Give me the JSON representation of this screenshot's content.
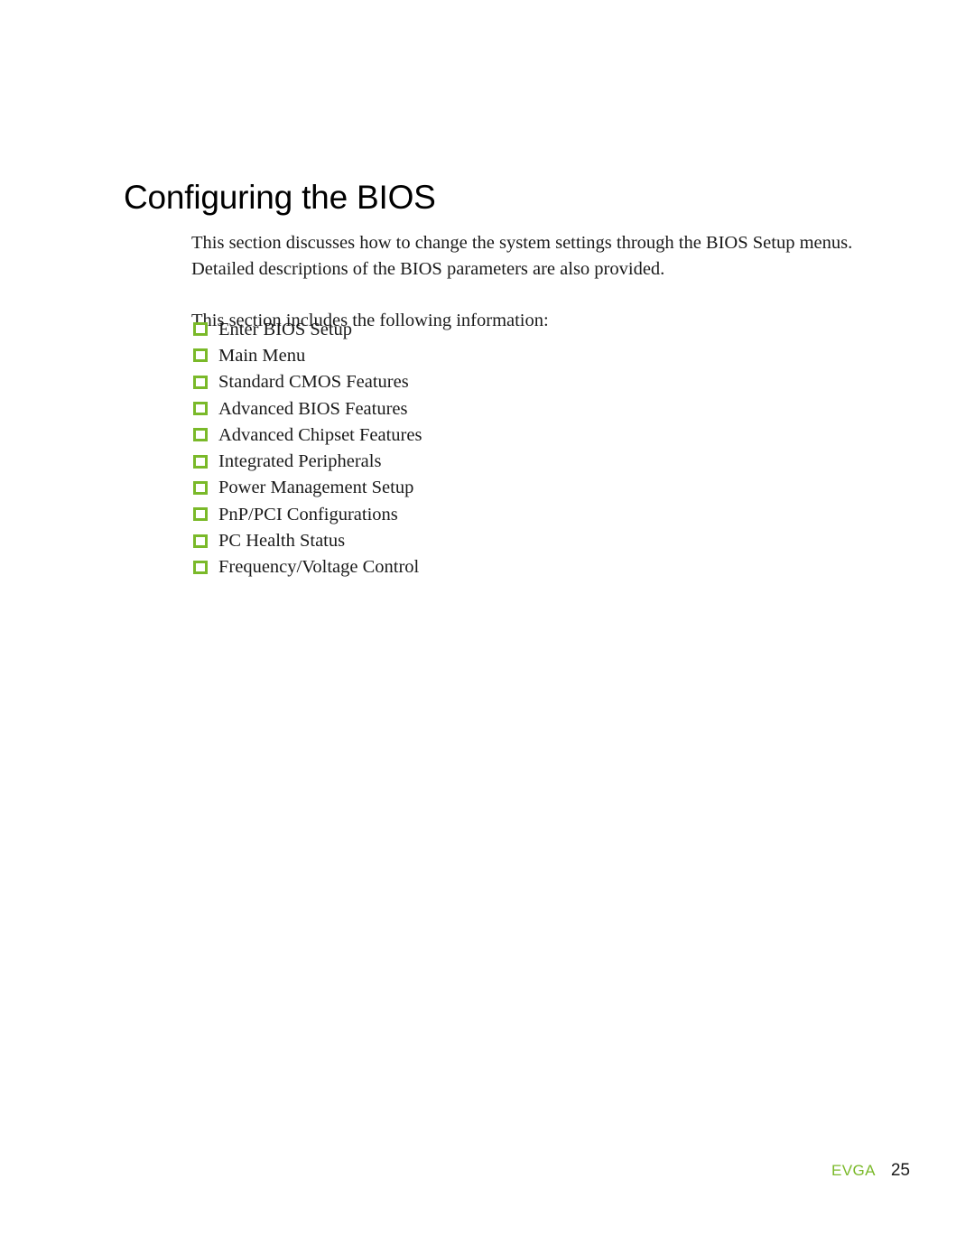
{
  "document": {
    "title": "Configuring the BIOS"
  },
  "intro": {
    "paragraph1": [
      "This section discusses how to change the system settings through the BIOS Setup menus.",
      "Detailed descriptions of the BIOS parameters are also provided."
    ],
    "paragraph2": [
      "This section includes the following information:"
    ]
  },
  "feature_list": {
    "bullet_icon": "empty-square-bullet-icon",
    "items": [
      {
        "label": "Enter BIOS Setup"
      },
      {
        "label": "Main Menu"
      },
      {
        "label": "Standard CMOS Features"
      },
      {
        "label": "Advanced BIOS Features"
      },
      {
        "label": "Advanced Chipset Features"
      },
      {
        "label": "Integrated Peripherals"
      },
      {
        "label": "Power Management Setup"
      },
      {
        "label": "PnP/PCI Configurations"
      },
      {
        "label": "PC Health Status"
      },
      {
        "label": "Frequency/Voltage Control"
      }
    ]
  },
  "footer": {
    "brand": "EVGA",
    "page_number": "25"
  },
  "colors": {
    "accent_green": "#7ab929",
    "text": "#1a1a1a",
    "title": "#000000",
    "background": "#ffffff"
  }
}
